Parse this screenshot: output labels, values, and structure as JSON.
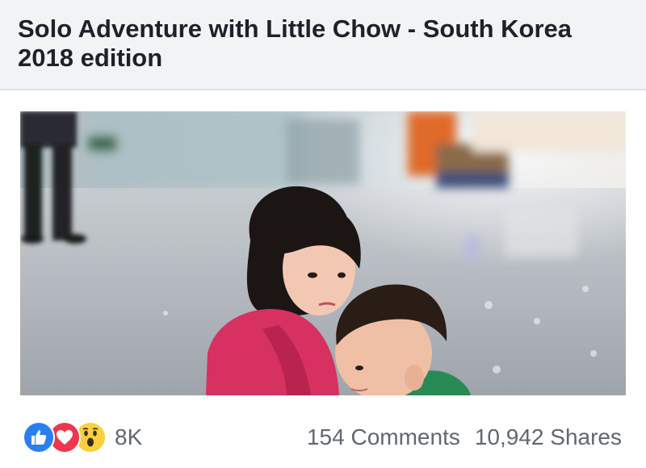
{
  "post": {
    "title": "Solo Adventure with Little Chow - South Korea 2018 edition"
  },
  "photo": {
    "subject": "two-children-hugging-in-airport-terminal"
  },
  "reactions": {
    "icons": [
      "like-icon",
      "love-icon",
      "wow-icon"
    ],
    "colors": {
      "like": "#2a7ff0",
      "love": "#f0364e",
      "wow": "#fbcf3d"
    },
    "count": "8K"
  },
  "stats": {
    "comments": "154 Comments",
    "shares": "10,942 Shares"
  },
  "theme": {
    "header_bg": "#f2f3f5",
    "title_color": "#1d2129",
    "meta_color": "#606770"
  }
}
